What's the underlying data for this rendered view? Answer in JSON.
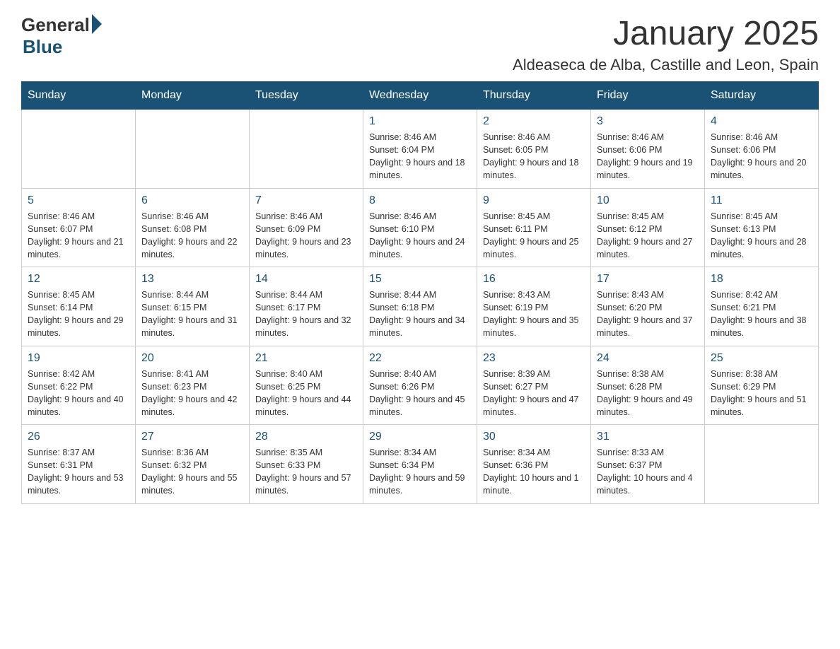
{
  "header": {
    "logo_general": "General",
    "logo_blue": "Blue",
    "month_title": "January 2025",
    "location": "Aldeaseca de Alba, Castille and Leon, Spain"
  },
  "weekdays": [
    "Sunday",
    "Monday",
    "Tuesday",
    "Wednesday",
    "Thursday",
    "Friday",
    "Saturday"
  ],
  "weeks": [
    [
      {
        "day": "",
        "info": ""
      },
      {
        "day": "",
        "info": ""
      },
      {
        "day": "",
        "info": ""
      },
      {
        "day": "1",
        "info": "Sunrise: 8:46 AM\nSunset: 6:04 PM\nDaylight: 9 hours and 18 minutes."
      },
      {
        "day": "2",
        "info": "Sunrise: 8:46 AM\nSunset: 6:05 PM\nDaylight: 9 hours and 18 minutes."
      },
      {
        "day": "3",
        "info": "Sunrise: 8:46 AM\nSunset: 6:06 PM\nDaylight: 9 hours and 19 minutes."
      },
      {
        "day": "4",
        "info": "Sunrise: 8:46 AM\nSunset: 6:06 PM\nDaylight: 9 hours and 20 minutes."
      }
    ],
    [
      {
        "day": "5",
        "info": "Sunrise: 8:46 AM\nSunset: 6:07 PM\nDaylight: 9 hours and 21 minutes."
      },
      {
        "day": "6",
        "info": "Sunrise: 8:46 AM\nSunset: 6:08 PM\nDaylight: 9 hours and 22 minutes."
      },
      {
        "day": "7",
        "info": "Sunrise: 8:46 AM\nSunset: 6:09 PM\nDaylight: 9 hours and 23 minutes."
      },
      {
        "day": "8",
        "info": "Sunrise: 8:46 AM\nSunset: 6:10 PM\nDaylight: 9 hours and 24 minutes."
      },
      {
        "day": "9",
        "info": "Sunrise: 8:45 AM\nSunset: 6:11 PM\nDaylight: 9 hours and 25 minutes."
      },
      {
        "day": "10",
        "info": "Sunrise: 8:45 AM\nSunset: 6:12 PM\nDaylight: 9 hours and 27 minutes."
      },
      {
        "day": "11",
        "info": "Sunrise: 8:45 AM\nSunset: 6:13 PM\nDaylight: 9 hours and 28 minutes."
      }
    ],
    [
      {
        "day": "12",
        "info": "Sunrise: 8:45 AM\nSunset: 6:14 PM\nDaylight: 9 hours and 29 minutes."
      },
      {
        "day": "13",
        "info": "Sunrise: 8:44 AM\nSunset: 6:15 PM\nDaylight: 9 hours and 31 minutes."
      },
      {
        "day": "14",
        "info": "Sunrise: 8:44 AM\nSunset: 6:17 PM\nDaylight: 9 hours and 32 minutes."
      },
      {
        "day": "15",
        "info": "Sunrise: 8:44 AM\nSunset: 6:18 PM\nDaylight: 9 hours and 34 minutes."
      },
      {
        "day": "16",
        "info": "Sunrise: 8:43 AM\nSunset: 6:19 PM\nDaylight: 9 hours and 35 minutes."
      },
      {
        "day": "17",
        "info": "Sunrise: 8:43 AM\nSunset: 6:20 PM\nDaylight: 9 hours and 37 minutes."
      },
      {
        "day": "18",
        "info": "Sunrise: 8:42 AM\nSunset: 6:21 PM\nDaylight: 9 hours and 38 minutes."
      }
    ],
    [
      {
        "day": "19",
        "info": "Sunrise: 8:42 AM\nSunset: 6:22 PM\nDaylight: 9 hours and 40 minutes."
      },
      {
        "day": "20",
        "info": "Sunrise: 8:41 AM\nSunset: 6:23 PM\nDaylight: 9 hours and 42 minutes."
      },
      {
        "day": "21",
        "info": "Sunrise: 8:40 AM\nSunset: 6:25 PM\nDaylight: 9 hours and 44 minutes."
      },
      {
        "day": "22",
        "info": "Sunrise: 8:40 AM\nSunset: 6:26 PM\nDaylight: 9 hours and 45 minutes."
      },
      {
        "day": "23",
        "info": "Sunrise: 8:39 AM\nSunset: 6:27 PM\nDaylight: 9 hours and 47 minutes."
      },
      {
        "day": "24",
        "info": "Sunrise: 8:38 AM\nSunset: 6:28 PM\nDaylight: 9 hours and 49 minutes."
      },
      {
        "day": "25",
        "info": "Sunrise: 8:38 AM\nSunset: 6:29 PM\nDaylight: 9 hours and 51 minutes."
      }
    ],
    [
      {
        "day": "26",
        "info": "Sunrise: 8:37 AM\nSunset: 6:31 PM\nDaylight: 9 hours and 53 minutes."
      },
      {
        "day": "27",
        "info": "Sunrise: 8:36 AM\nSunset: 6:32 PM\nDaylight: 9 hours and 55 minutes."
      },
      {
        "day": "28",
        "info": "Sunrise: 8:35 AM\nSunset: 6:33 PM\nDaylight: 9 hours and 57 minutes."
      },
      {
        "day": "29",
        "info": "Sunrise: 8:34 AM\nSunset: 6:34 PM\nDaylight: 9 hours and 59 minutes."
      },
      {
        "day": "30",
        "info": "Sunrise: 8:34 AM\nSunset: 6:36 PM\nDaylight: 10 hours and 1 minute."
      },
      {
        "day": "31",
        "info": "Sunrise: 8:33 AM\nSunset: 6:37 PM\nDaylight: 10 hours and 4 minutes."
      },
      {
        "day": "",
        "info": ""
      }
    ]
  ]
}
